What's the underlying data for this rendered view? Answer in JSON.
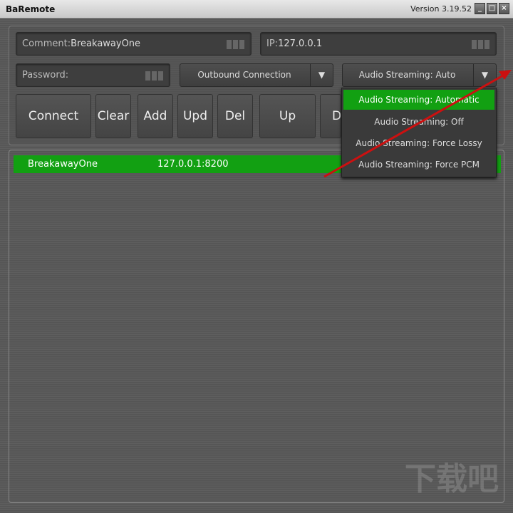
{
  "window": {
    "title": "BaRemote",
    "version": "Version 3.19.52",
    "min": "_",
    "max": "□",
    "close": "×"
  },
  "form": {
    "comment_label": "Comment:",
    "comment_value": "BreakawayOne",
    "ip_label": "IP:",
    "ip_value": "127.0.0.1",
    "password_label": "Password:",
    "connection_mode": "Outbound Connection",
    "audio_streaming": "Audio Streaming: Auto"
  },
  "buttons": [
    "Connect",
    "Clear",
    "Add",
    "Upd",
    "Del",
    "Up",
    "D"
  ],
  "dropdown": {
    "options": [
      "Audio Streaming: Automatic",
      "Audio Streaming: Off",
      "Audio Streaming: Force Lossy",
      "Audio Streaming: Force PCM"
    ],
    "selected": 0
  },
  "list": {
    "rows": [
      {
        "name": "BreakawayOne",
        "address": "127.0.0.1:8200"
      }
    ]
  },
  "colors": {
    "selected": "#12a012",
    "annotation_arrow": "#cc1010"
  },
  "watermark": "下载吧"
}
